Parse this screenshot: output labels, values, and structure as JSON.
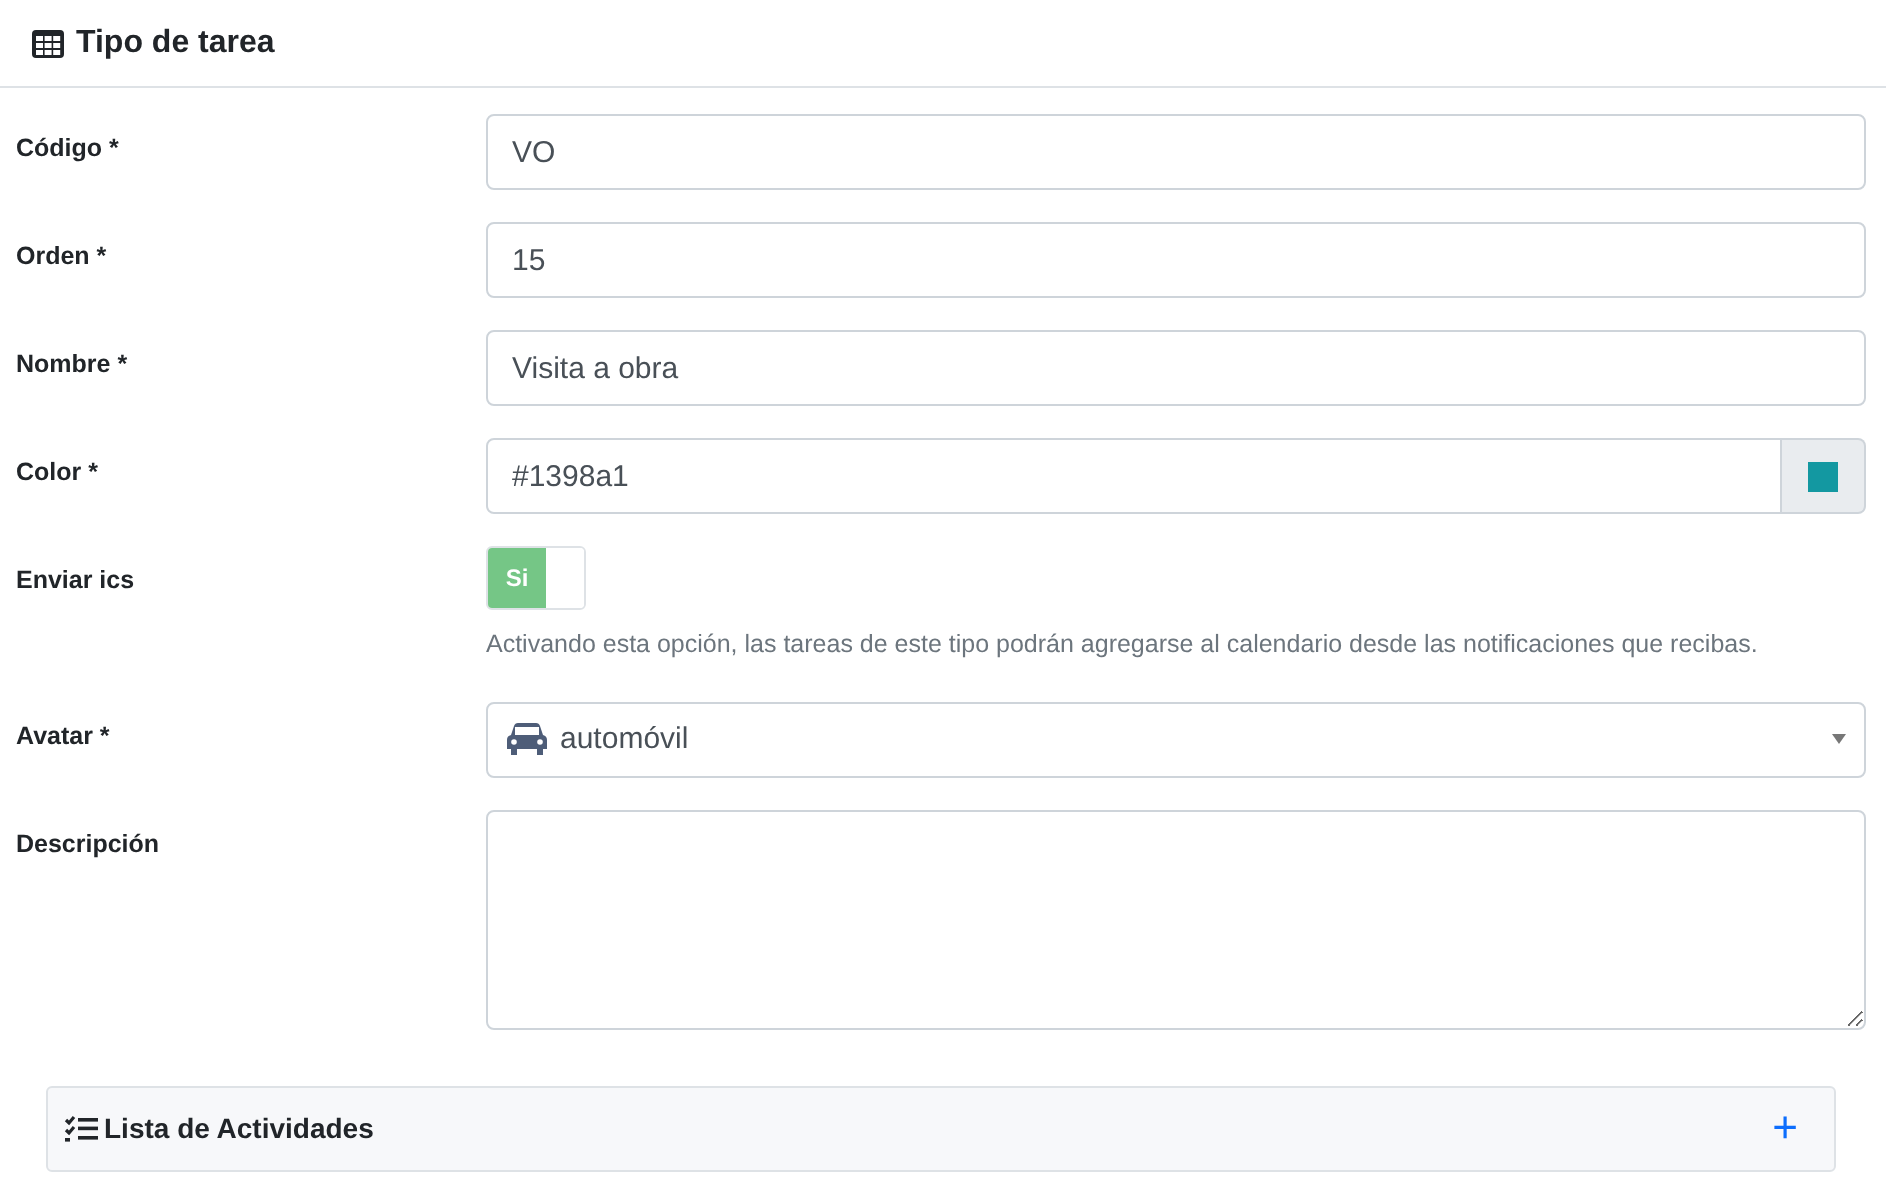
{
  "header": {
    "title": "Tipo de tarea"
  },
  "fields": [
    {
      "kind": "text",
      "label": "Código *",
      "value": "VO"
    },
    {
      "kind": "text",
      "label": "Orden *",
      "value": "15"
    },
    {
      "kind": "text",
      "label": "Nombre *",
      "value": "Visita a obra"
    },
    {
      "kind": "color",
      "label": "Color *",
      "value": "#1398a1"
    },
    {
      "kind": "toggle",
      "label": "Enviar ics",
      "on_label": "Si",
      "on": true,
      "help": "Activando esta opción, las tareas de este tipo podrán agregarse al calendario desde las notificaciones que recibas."
    },
    {
      "kind": "select",
      "label": "Avatar *",
      "value": "automóvil"
    },
    {
      "kind": "textarea",
      "label": "Descripción"
    }
  ],
  "panel": {
    "title": "Lista de Actividades",
    "add": "+"
  }
}
